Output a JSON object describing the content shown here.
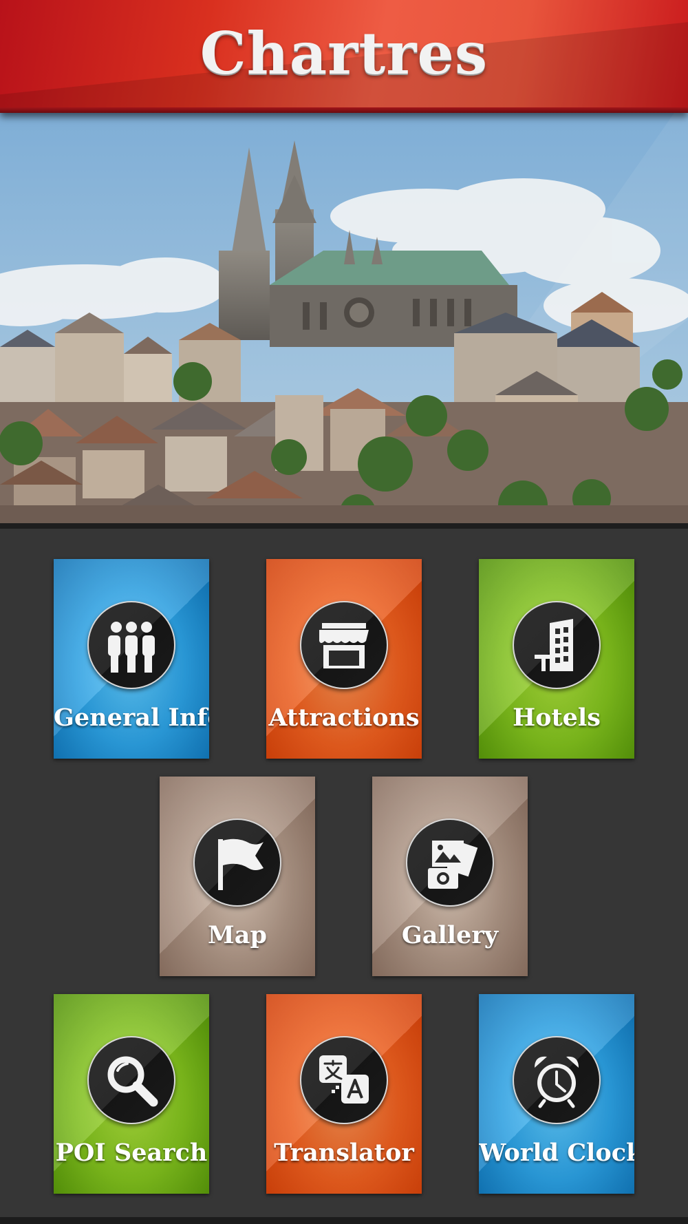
{
  "header": {
    "title": "Chartres"
  },
  "hero": {
    "image": "cathedral-cityscape-photo"
  },
  "menu": {
    "general_info": {
      "label": "General Info",
      "icon": "people-icon",
      "color": "#1a8fd6"
    },
    "attractions": {
      "label": "Attractions",
      "icon": "storefront-icon",
      "color": "#e84e14"
    },
    "hotels": {
      "label": "Hotels",
      "icon": "building-icon",
      "color": "#6fb014"
    },
    "map": {
      "label": "Map",
      "icon": "flag-icon",
      "color": "#a08878"
    },
    "gallery": {
      "label": "Gallery",
      "icon": "photo-camera-icon",
      "color": "#a08878"
    },
    "poi_search": {
      "label": "POI Search",
      "icon": "magnifier-icon",
      "color": "#6fb014"
    },
    "translator": {
      "label": "Translator",
      "icon": "translate-icon",
      "color": "#e84e14"
    },
    "world_clock": {
      "label": "World Clock",
      "icon": "alarm-clock-icon",
      "color": "#1a8fd6"
    }
  },
  "colors": {
    "header_red": "#d9301f",
    "background": "#363636",
    "icon_circle": "#222222"
  }
}
